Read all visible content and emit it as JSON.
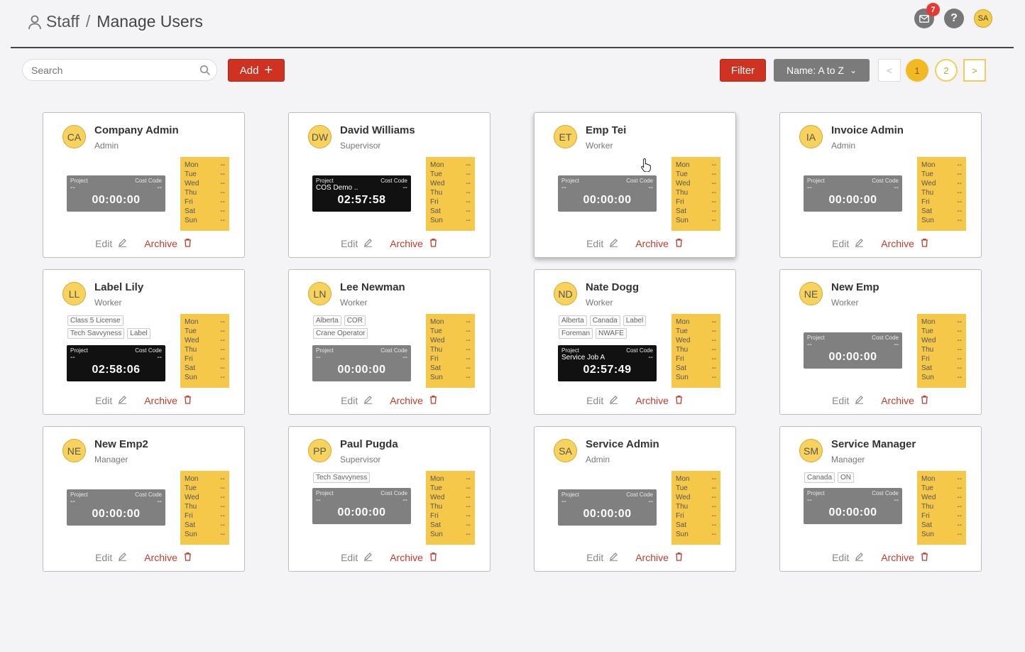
{
  "breadcrumb": {
    "parent": "Staff",
    "separator": "/",
    "current": "Manage Users"
  },
  "header": {
    "mail_badge": "7",
    "help_glyph": "?",
    "user_initials": "SA"
  },
  "toolbar": {
    "search_placeholder": "Search",
    "add_label": "Add",
    "add_glyph": "+",
    "filter_label": "Filter",
    "sort_label": "Name: A to Z",
    "sort_chevron": "⌄",
    "prev_glyph": "<",
    "next_glyph": ">",
    "pages": [
      "1",
      "2"
    ]
  },
  "labels": {
    "project": "Project",
    "cost_code": "Cost Code",
    "edit": "Edit",
    "archive": "Archive",
    "empty": "--"
  },
  "days": [
    "Mon",
    "Tue",
    "Wed",
    "Thu",
    "Fri",
    "Sat",
    "Sun"
  ],
  "users": [
    {
      "initials": "CA",
      "name": "Company Admin",
      "role": "Admin",
      "tags": [],
      "project": "--",
      "cost_code": "--",
      "time": "00:00:00",
      "active": false
    },
    {
      "initials": "DW",
      "name": "David Williams",
      "role": "Supervisor",
      "tags": [],
      "project": "COS Demo ..",
      "cost_code": "--",
      "time": "02:57:58",
      "active": true
    },
    {
      "initials": "ET",
      "name": "Emp Tei",
      "role": "Worker",
      "tags": [],
      "project": "--",
      "cost_code": "--",
      "time": "00:00:00",
      "active": false
    },
    {
      "initials": "IA",
      "name": "Invoice Admin",
      "role": "Admin",
      "tags": [],
      "project": "--",
      "cost_code": "--",
      "time": "00:00:00",
      "active": false
    },
    {
      "initials": "LL",
      "name": "Label Lily",
      "role": "Worker",
      "tags": [
        "Class 5 License",
        "Tech Savvyness",
        "Label"
      ],
      "project": "--",
      "cost_code": "--",
      "time": "02:58:06",
      "active": true
    },
    {
      "initials": "LN",
      "name": "Lee Newman",
      "role": "Worker",
      "tags": [
        "Alberta",
        "COR",
        "Crane Operator"
      ],
      "project": "--",
      "cost_code": "--",
      "time": "00:00:00",
      "active": false
    },
    {
      "initials": "ND",
      "name": "Nate Dogg",
      "role": "Worker",
      "tags": [
        "Alberta",
        "Canada",
        "Label",
        "Foreman",
        "NWAFE"
      ],
      "project": "Service Job A",
      "cost_code": "--",
      "time": "02:57:49",
      "active": true
    },
    {
      "initials": "NE",
      "name": "New Emp",
      "role": "Worker",
      "tags": [],
      "project": "--",
      "cost_code": "--",
      "time": "00:00:00",
      "active": false
    },
    {
      "initials": "NE",
      "name": "New Emp2",
      "role": "Manager",
      "tags": [],
      "project": "--",
      "cost_code": "--",
      "time": "00:00:00",
      "active": false
    },
    {
      "initials": "PP",
      "name": "Paul Pugda",
      "role": "Supervisor",
      "tags": [
        "Tech Savvyness"
      ],
      "project": "--",
      "cost_code": "--",
      "time": "00:00:00",
      "active": false
    },
    {
      "initials": "SA",
      "name": "Service Admin",
      "role": "Admin",
      "tags": [],
      "project": "--",
      "cost_code": "--",
      "time": "00:00:00",
      "active": false
    },
    {
      "initials": "SM",
      "name": "Service Manager",
      "role": "Manager",
      "tags": [
        "Canada",
        "ON"
      ],
      "project": "--",
      "cost_code": "--",
      "time": "00:00:00",
      "active": false
    }
  ],
  "colors": {
    "accent_red": "#cf3221",
    "accent_yellow": "#f6c84a",
    "timer_idle": "#808080",
    "timer_active": "#111111"
  }
}
